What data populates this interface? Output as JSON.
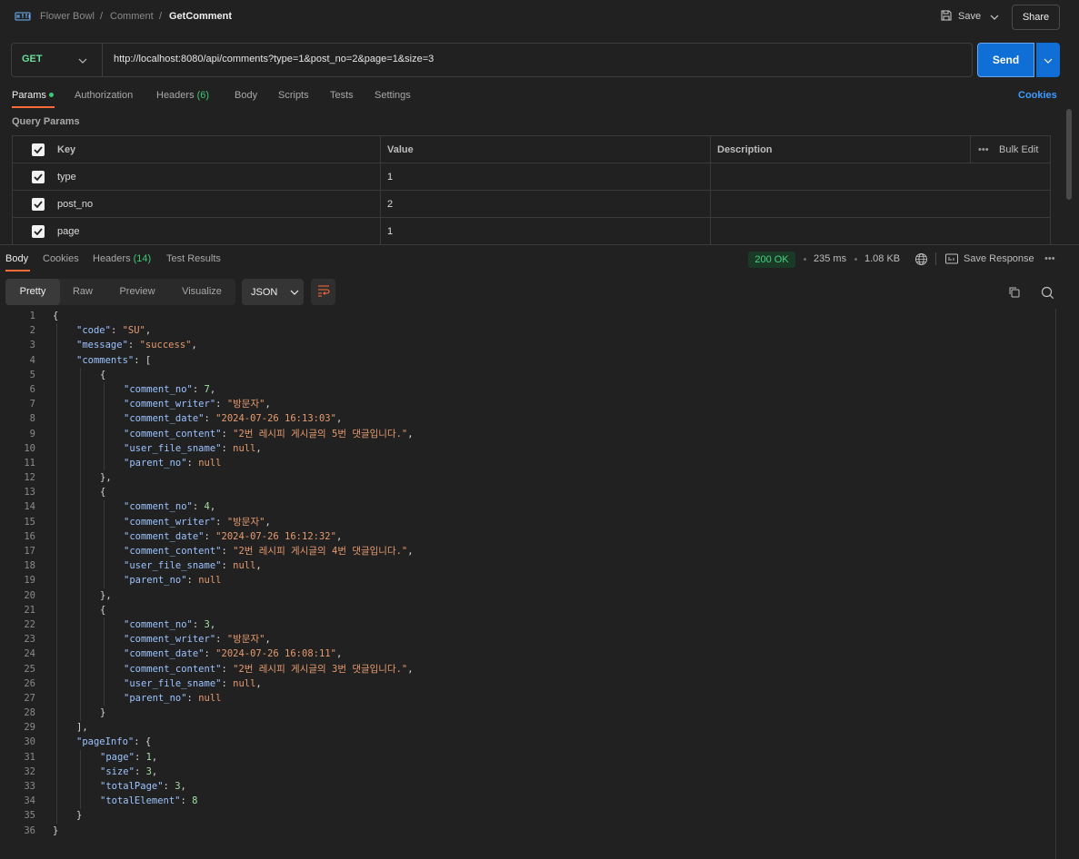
{
  "topbar": {
    "breadcrumb": [
      "Flower Bowl",
      "Comment",
      "GetComment"
    ],
    "save_label": "Save",
    "share_label": "Share"
  },
  "request": {
    "method": "GET",
    "url": "http://localhost:8080/api/comments?type=1&post_no=2&page=1&size=3",
    "send_label": "Send",
    "tabs": [
      "Params",
      "Authorization",
      "Headers",
      "Body",
      "Scripts",
      "Tests",
      "Settings"
    ],
    "headers_count": "(6)",
    "cookies_label": "Cookies",
    "query_params_label": "Query Params",
    "table": {
      "headers": [
        "Key",
        "Value",
        "Description"
      ],
      "bulk_edit": "Bulk Edit",
      "rows": [
        {
          "key": "type",
          "value": "1"
        },
        {
          "key": "post_no",
          "value": "2"
        },
        {
          "key": "page",
          "value": "1"
        }
      ]
    }
  },
  "response": {
    "tabs": [
      "Body",
      "Cookies",
      "Headers",
      "Test Results"
    ],
    "headers_count": "(14)",
    "status": "200 OK",
    "time": "235 ms",
    "size": "1.08 KB",
    "save_response_label": "Save Response",
    "view_modes": [
      "Pretty",
      "Raw",
      "Preview",
      "Visualize"
    ],
    "format": "JSON",
    "line_numbers": [
      "1",
      "2",
      "3",
      "4",
      "5",
      "6",
      "7",
      "8",
      "9",
      "10",
      "11",
      "12",
      "13",
      "14",
      "15",
      "16",
      "17",
      "18",
      "19",
      "20",
      "21",
      "22",
      "23",
      "24",
      "25",
      "26",
      "27",
      "28",
      "29",
      "30",
      "31",
      "32",
      "33",
      "34",
      "35",
      "36"
    ],
    "lines": [
      [
        [
          "p",
          "{"
        ]
      ],
      [
        [
          "k",
          "\"code\""
        ],
        [
          "p",
          ": "
        ],
        [
          "s",
          "\"SU\""
        ],
        [
          "p",
          ","
        ]
      ],
      [
        [
          "k",
          "\"message\""
        ],
        [
          "p",
          ": "
        ],
        [
          "s",
          "\"success\""
        ],
        [
          "p",
          ","
        ]
      ],
      [
        [
          "k",
          "\"comments\""
        ],
        [
          "p",
          ": ["
        ]
      ],
      [
        [
          "p",
          "{"
        ]
      ],
      [
        [
          "k",
          "\"comment_no\""
        ],
        [
          "p",
          ": "
        ],
        [
          "n",
          "7"
        ],
        [
          "p",
          ","
        ]
      ],
      [
        [
          "k",
          "\"comment_writer\""
        ],
        [
          "p",
          ": "
        ],
        [
          "s",
          "\"방문자\""
        ],
        [
          "p",
          ","
        ]
      ],
      [
        [
          "k",
          "\"comment_date\""
        ],
        [
          "p",
          ": "
        ],
        [
          "s",
          "\"2024-07-26 16:13:03\""
        ],
        [
          "p",
          ","
        ]
      ],
      [
        [
          "k",
          "\"comment_content\""
        ],
        [
          "p",
          ": "
        ],
        [
          "s",
          "\"2번 레시피 게시글의 5번 댓글입니다.\""
        ],
        [
          "p",
          ","
        ]
      ],
      [
        [
          "k",
          "\"user_file_sname\""
        ],
        [
          "p",
          ": "
        ],
        [
          "nl",
          "null"
        ],
        [
          "p",
          ","
        ]
      ],
      [
        [
          "k",
          "\"parent_no\""
        ],
        [
          "p",
          ": "
        ],
        [
          "nl",
          "null"
        ]
      ],
      [
        [
          "p",
          "},"
        ]
      ],
      [
        [
          "p",
          "{"
        ]
      ],
      [
        [
          "k",
          "\"comment_no\""
        ],
        [
          "p",
          ": "
        ],
        [
          "n",
          "4"
        ],
        [
          "p",
          ","
        ]
      ],
      [
        [
          "k",
          "\"comment_writer\""
        ],
        [
          "p",
          ": "
        ],
        [
          "s",
          "\"방문자\""
        ],
        [
          "p",
          ","
        ]
      ],
      [
        [
          "k",
          "\"comment_date\""
        ],
        [
          "p",
          ": "
        ],
        [
          "s",
          "\"2024-07-26 16:12:32\""
        ],
        [
          "p",
          ","
        ]
      ],
      [
        [
          "k",
          "\"comment_content\""
        ],
        [
          "p",
          ": "
        ],
        [
          "s",
          "\"2번 레시피 게시글의 4번 댓글입니다.\""
        ],
        [
          "p",
          ","
        ]
      ],
      [
        [
          "k",
          "\"user_file_sname\""
        ],
        [
          "p",
          ": "
        ],
        [
          "nl",
          "null"
        ],
        [
          "p",
          ","
        ]
      ],
      [
        [
          "k",
          "\"parent_no\""
        ],
        [
          "p",
          ": "
        ],
        [
          "nl",
          "null"
        ]
      ],
      [
        [
          "p",
          "},"
        ]
      ],
      [
        [
          "p",
          "{"
        ]
      ],
      [
        [
          "k",
          "\"comment_no\""
        ],
        [
          "p",
          ": "
        ],
        [
          "n",
          "3"
        ],
        [
          "p",
          ","
        ]
      ],
      [
        [
          "k",
          "\"comment_writer\""
        ],
        [
          "p",
          ": "
        ],
        [
          "s",
          "\"방문자\""
        ],
        [
          "p",
          ","
        ]
      ],
      [
        [
          "k",
          "\"comment_date\""
        ],
        [
          "p",
          ": "
        ],
        [
          "s",
          "\"2024-07-26 16:08:11\""
        ],
        [
          "p",
          ","
        ]
      ],
      [
        [
          "k",
          "\"comment_content\""
        ],
        [
          "p",
          ": "
        ],
        [
          "s",
          "\"2번 레시피 게시글의 3번 댓글입니다.\""
        ],
        [
          "p",
          ","
        ]
      ],
      [
        [
          "k",
          "\"user_file_sname\""
        ],
        [
          "p",
          ": "
        ],
        [
          "nl",
          "null"
        ],
        [
          "p",
          ","
        ]
      ],
      [
        [
          "k",
          "\"parent_no\""
        ],
        [
          "p",
          ": "
        ],
        [
          "nl",
          "null"
        ]
      ],
      [
        [
          "p",
          "}"
        ]
      ],
      [
        [
          "p",
          "],"
        ]
      ],
      [
        [
          "k",
          "\"pageInfo\""
        ],
        [
          "p",
          ": {"
        ]
      ],
      [
        [
          "k",
          "\"page\""
        ],
        [
          "p",
          ": "
        ],
        [
          "n",
          "1"
        ],
        [
          "p",
          ","
        ]
      ],
      [
        [
          "k",
          "\"size\""
        ],
        [
          "p",
          ": "
        ],
        [
          "n",
          "3"
        ],
        [
          "p",
          ","
        ]
      ],
      [
        [
          "k",
          "\"totalPage\""
        ],
        [
          "p",
          ": "
        ],
        [
          "n",
          "3"
        ],
        [
          "p",
          ","
        ]
      ],
      [
        [
          "k",
          "\"totalElement\""
        ],
        [
          "p",
          ": "
        ],
        [
          "n",
          "8"
        ]
      ],
      [
        [
          "p",
          "}"
        ]
      ],
      [
        [
          "p",
          "}"
        ]
      ]
    ]
  }
}
